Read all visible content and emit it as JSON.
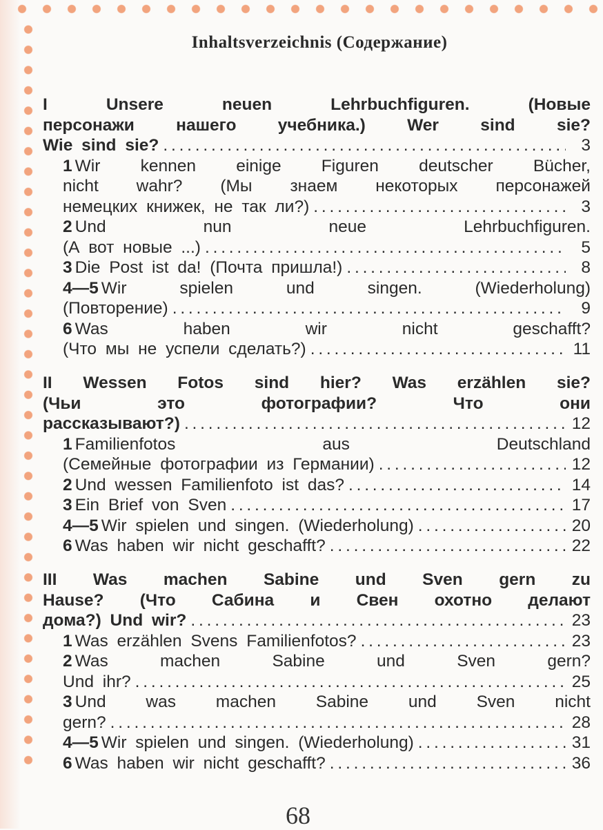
{
  "title": "Inhaltsverzeichnis (Содержание)",
  "page_number": "68",
  "accent_color": "#f2a47e",
  "sections": [
    {
      "entries": [
        {
          "num": "",
          "lines": [
            "I Unsere neuen Lehrbuchfiguren. (Новые",
            "персонажи нашего учебника.) Wer sind sie?",
            "Wie sind sie?"
          ],
          "page": "3"
        },
        {
          "num": "1",
          "lines": [
            "Wir kennen einige Figuren deutscher Bücher,",
            "nicht wahr? (Мы знаем некоторых персонажей",
            "немецких книжек, не так ли?)"
          ],
          "page": "3"
        },
        {
          "num": "2",
          "lines": [
            "Und nun neue Lehrbuchfiguren.",
            "(А вот новые ...)"
          ],
          "page": "5"
        },
        {
          "num": "3",
          "lines": [
            "Die Post ist da! (Почта пришла!)"
          ],
          "page": "8"
        },
        {
          "num": "4—5",
          "lines": [
            "Wir spielen und singen. (Wiederholung)",
            "(Повторение)"
          ],
          "page": "9"
        },
        {
          "num": "6",
          "lines": [
            "Was haben wir nicht geschafft?",
            "(Что мы не успели сделать?)"
          ],
          "page": "11"
        }
      ]
    },
    {
      "entries": [
        {
          "num": "",
          "lines": [
            "II Wessen Fotos sind hier? Was erzählen sie?",
            "(Чьи это фотографии? Что они",
            "рассказывают?)"
          ],
          "page": "12"
        },
        {
          "num": "1",
          "lines": [
            "Familienfotos aus Deutschland",
            "(Семейные фотографии из Германии)"
          ],
          "page": "12"
        },
        {
          "num": "2",
          "lines": [
            "Und wessen Familienfoto ist das?"
          ],
          "page": "14"
        },
        {
          "num": "3",
          "lines": [
            "Ein Brief von Sven"
          ],
          "page": "17"
        },
        {
          "num": "4—5",
          "lines": [
            "Wir spielen und singen. (Wiederholung)"
          ],
          "page": "20"
        },
        {
          "num": "6",
          "lines": [
            "Was haben wir nicht geschafft?"
          ],
          "page": "22"
        }
      ]
    },
    {
      "entries": [
        {
          "num": "",
          "lines": [
            "III Was machen Sabine und Sven gern zu",
            "Hause? (Что Сабина и Свен охотно делают",
            "дома?) Und wir?"
          ],
          "page": "23"
        },
        {
          "num": "1",
          "lines": [
            "Was erzählen Svens Familienfotos?"
          ],
          "page": "23"
        },
        {
          "num": "2",
          "lines": [
            "Was machen Sabine und Sven gern?",
            "Und ihr?"
          ],
          "page": "25"
        },
        {
          "num": "3",
          "lines": [
            "Und was machen Sabine und Sven nicht",
            "gern?"
          ],
          "page": "28"
        },
        {
          "num": "4—5",
          "lines": [
            "Wir spielen und singen. (Wiederholung)"
          ],
          "page": "31"
        },
        {
          "num": "6",
          "lines": [
            "Was haben wir nicht geschafft?"
          ],
          "page": "36"
        }
      ]
    }
  ]
}
